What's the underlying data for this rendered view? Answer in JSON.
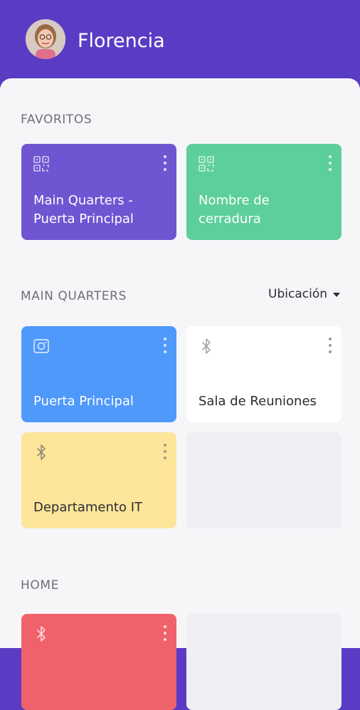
{
  "header": {
    "username": "Florencia"
  },
  "favorites": {
    "title": "FAVORITOS",
    "cards": [
      {
        "label": "Main Quarters - Puerta Principal",
        "icon": "qr-code-icon",
        "color": "#6f55d2"
      },
      {
        "label": "Nombre de cerradura",
        "icon": "qr-code-icon",
        "color": "#5dcf9a"
      }
    ]
  },
  "main_quarters": {
    "title": "MAIN QUARTERS",
    "location_filter": "Ubicación",
    "cards": [
      {
        "label": "Puerta Principal",
        "icon": "camera-icon",
        "color": "#4f99fb"
      },
      {
        "label": "Sala de Reuniones",
        "icon": "bluetooth-icon",
        "color": "#ffffff"
      },
      {
        "label": "Departamento IT",
        "icon": "bluetooth-icon",
        "color": "#fde69a"
      }
    ]
  },
  "home": {
    "title": "HOME",
    "cards": [
      {
        "label": "",
        "icon": "bluetooth-icon",
        "color": "#f0626b"
      }
    ]
  }
}
